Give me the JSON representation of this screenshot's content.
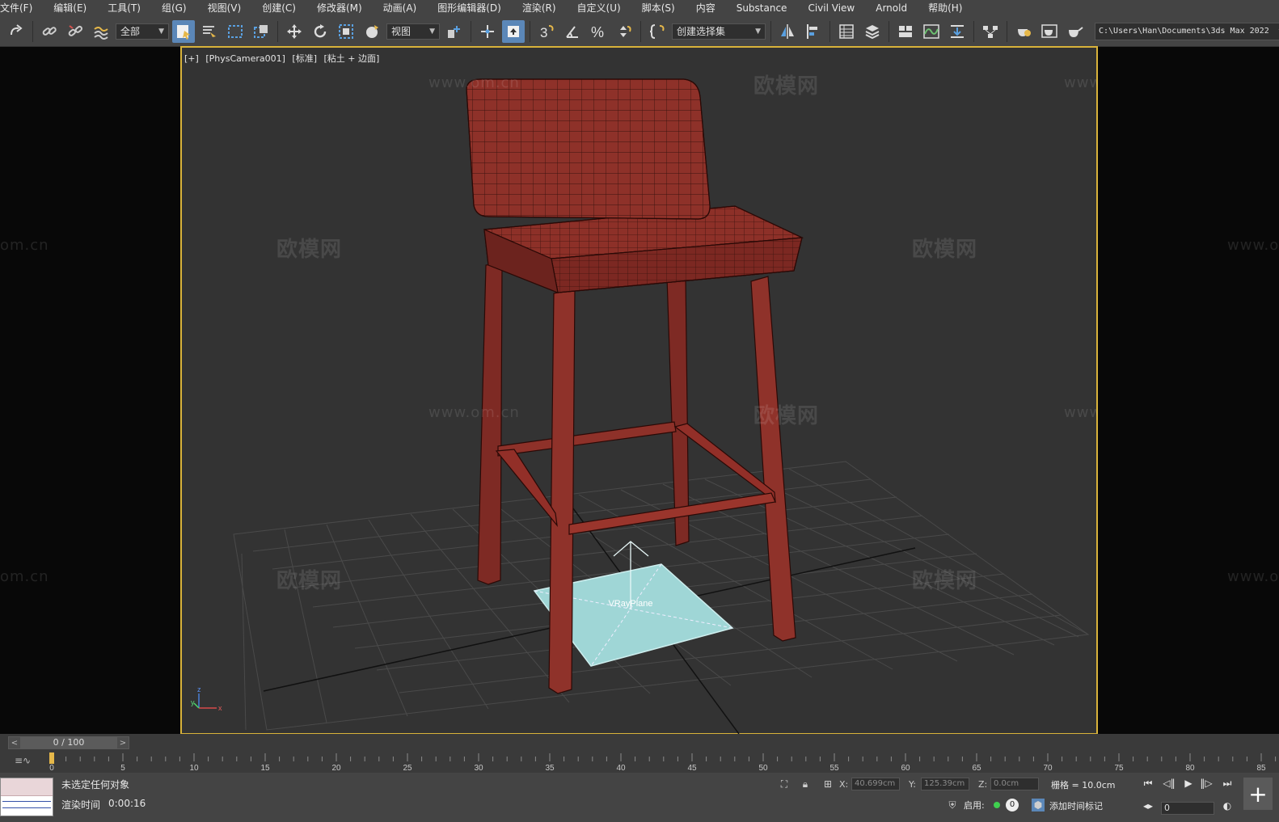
{
  "menu": [
    "文件(F)",
    "编辑(E)",
    "工具(T)",
    "组(G)",
    "视图(V)",
    "创建(C)",
    "修改器(M)",
    "动画(A)",
    "图形编辑器(D)",
    "渲染(R)",
    "自定义(U)",
    "脚本(S)",
    "内容",
    "Substance",
    "Civil View",
    "Arnold",
    "帮助(H)"
  ],
  "toolbar": {
    "filter_value": "全部",
    "coord_system": "视图",
    "selection_set_placeholder": "创建选择集",
    "project_path": "C:\\Users\\Han\\Documents\\3ds Max 2022",
    "snap_value": "3"
  },
  "viewport": {
    "label_parts": [
      "[+]",
      "[PhysCamera001]",
      "[标准]",
      "[粘土 + 边面]"
    ],
    "object_label": "VRayPlane",
    "watermark_brand": "欧模网",
    "watermark_url": "www.om.cn",
    "watermark_url_short": "om.cn",
    "axis_labels": [
      "z",
      "y",
      "x"
    ]
  },
  "timeline": {
    "current": "0 / 100",
    "ruler_labels": [
      "0",
      "5",
      "10",
      "15",
      "20",
      "25",
      "30",
      "35",
      "40",
      "45",
      "50",
      "55",
      "60",
      "65",
      "70",
      "75",
      "80",
      "85"
    ]
  },
  "status": {
    "selection": "未选定任何对象",
    "render_time_label": "渲染时间",
    "render_time": "0:00:16",
    "x_label": "X:",
    "x_value": "40.699cm",
    "y_label": "Y:",
    "y_value": "125.39cm",
    "z_label": "Z:",
    "z_value": "0.0cm",
    "grid": "栅格 = 10.0cm",
    "enable_label": "启用:",
    "enable_count": "0",
    "add_time_tag": "添加时间标记",
    "frame_value": "0"
  },
  "colors": {
    "ui_bg": "#444444",
    "viewport_bg": "#333333",
    "viewport_border": "#d8b23a",
    "chair_wire": "#8a2f28",
    "vray_plane": "#9fd6d6",
    "active_button": "#5b87b8"
  }
}
